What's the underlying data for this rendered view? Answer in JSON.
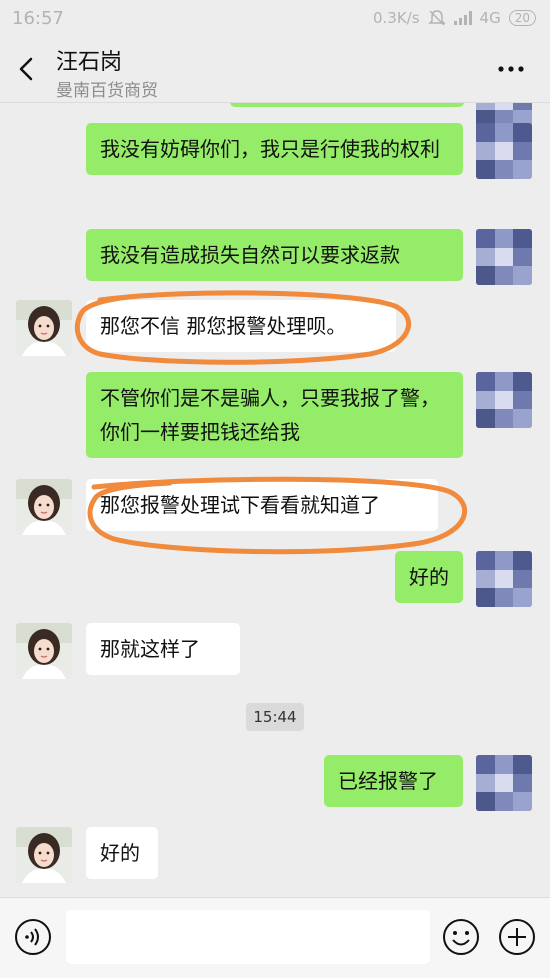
{
  "status_bar": {
    "time": "16:57",
    "speed": "0.3K/s",
    "network": "4G",
    "battery": "20"
  },
  "header": {
    "title": "汪石岗",
    "subtitle": "曼南百货商贸"
  },
  "messages": [
    {
      "from": "me",
      "text": "我没有妨碍你们，我只是行使我的权利"
    },
    {
      "from": "me",
      "text": "我没有造成损失自然可以要求返款"
    },
    {
      "from": "other",
      "text": "那您不信 那您报警处理呗。"
    },
    {
      "from": "me",
      "text": "不管你们是不是骗人，只要我报了警，你们一样要把钱还给我"
    },
    {
      "from": "other",
      "text": "那您报警处理试下看看就知道了"
    },
    {
      "from": "me",
      "text": "好的"
    },
    {
      "from": "other",
      "text": "那就这样了"
    },
    {
      "from": "me",
      "text": "已经报警了"
    },
    {
      "from": "other",
      "text": "好的"
    }
  ],
  "timestamp": "15:44",
  "colors": {
    "my_bubble": "#95ec69",
    "their_bubble": "#ffffff",
    "annotation": "#f08a3c",
    "background": "#ededed"
  },
  "icons": [
    "back-arrow-icon",
    "more-options-icon",
    "voice-icon",
    "emoji-icon",
    "plus-icon",
    "signal-icon",
    "mute-icon"
  ]
}
